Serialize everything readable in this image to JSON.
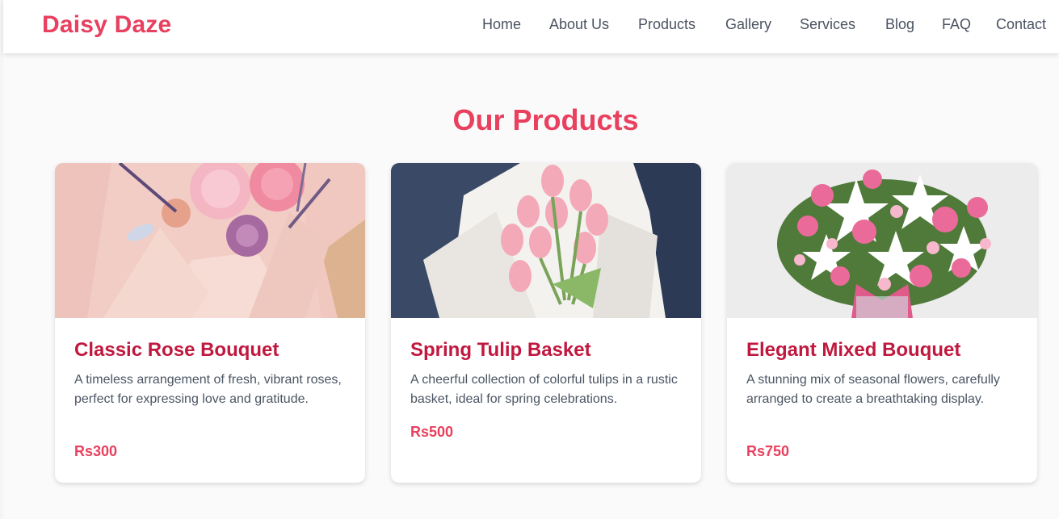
{
  "brand": "Daisy Daze",
  "nav": [
    "Home",
    "About Us",
    "Products",
    "Gallery",
    "Services",
    "Blog",
    "FAQ",
    "Contact"
  ],
  "section_title": "Our Products",
  "products": [
    {
      "title": "Classic Rose Bouquet",
      "description": "A timeless arrangement of fresh, vibrant roses, perfect for expressing love and gratitude.",
      "price": "Rs300",
      "image": "pink-dried-flower-bouquet-photo"
    },
    {
      "title": "Spring Tulip Basket",
      "description": "A cheerful collection of colorful tulips in a rustic basket, ideal for spring celebrations.",
      "price": "Rs500",
      "image": "pink-tulip-bouquet-photo"
    },
    {
      "title": "Elegant Mixed Bouquet",
      "description": "A stunning mix of seasonal flowers, carefully arranged to create a breathtaking display.",
      "price": "Rs750",
      "image": "pink-roses-white-lilies-vase-photo"
    }
  ],
  "colors": {
    "accent": "#e8405e",
    "card_title": "#c0183f",
    "nav_text": "#4a5361",
    "body_text": "#4b5563"
  }
}
